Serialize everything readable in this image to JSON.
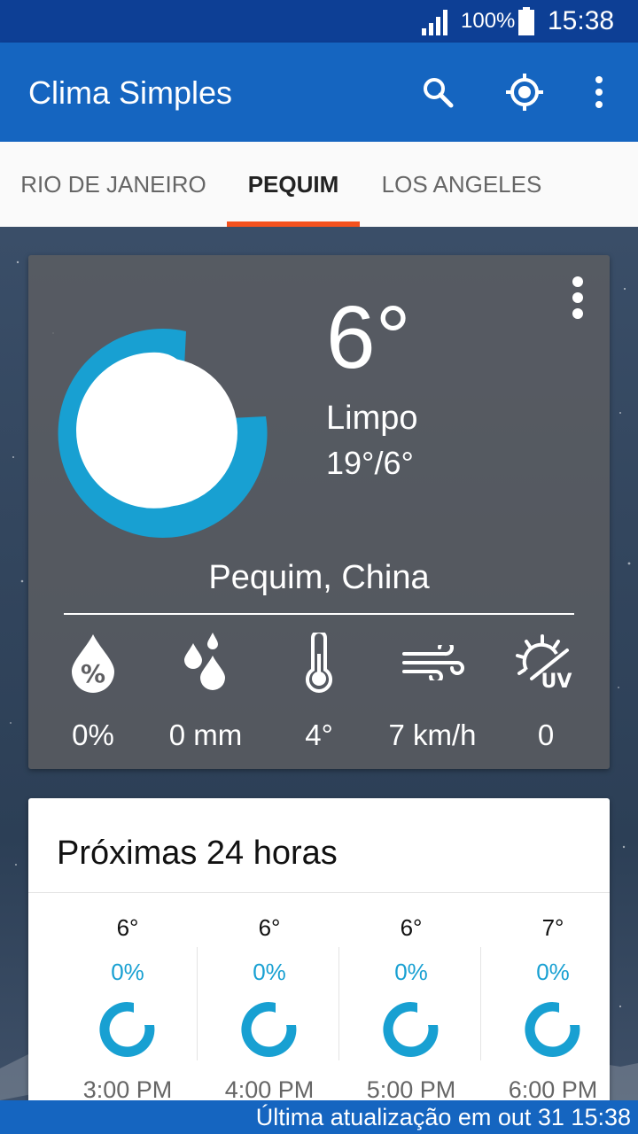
{
  "status_bar": {
    "battery_percent": "100%",
    "time": "15:38",
    "icons": [
      "signal-icon",
      "battery-icon"
    ]
  },
  "app_bar": {
    "title": "Clima Simples",
    "actions": [
      "search-icon",
      "my-location-icon",
      "overflow-menu-icon"
    ]
  },
  "tabs": [
    {
      "label": "RIO DE JANEIRO",
      "selected": false
    },
    {
      "label": "PEQUIM",
      "selected": true
    },
    {
      "label": "LOS ANGELES",
      "selected": false
    }
  ],
  "colors": {
    "primary": "#1565c0",
    "status_bar": "#0d3f95",
    "accent": "#f4511e",
    "moon_ring": "#18a0d2"
  },
  "current": {
    "temperature": "6°",
    "condition": "Limpo",
    "range": "19°/6°",
    "location": "Pequim, China",
    "icon": "clear-night-moon-icon",
    "stats": [
      {
        "icon": "precipitation-probability-icon",
        "value": "0%"
      },
      {
        "icon": "precipitation-amount-icon",
        "value": "0 mm"
      },
      {
        "icon": "thermometer-icon",
        "value": "4°"
      },
      {
        "icon": "wind-icon",
        "value": "7 km/h"
      },
      {
        "icon": "uv-index-icon",
        "value": "0"
      }
    ]
  },
  "hourly": {
    "title": "Próximas 24 horas",
    "items": [
      {
        "temp": "6°",
        "prob": "0%",
        "time": "3:00 PM",
        "icon": "moon-icon"
      },
      {
        "temp": "6°",
        "prob": "0%",
        "time": "4:00 PM",
        "icon": "moon-icon"
      },
      {
        "temp": "6°",
        "prob": "0%",
        "time": "5:00 PM",
        "icon": "moon-icon"
      },
      {
        "temp": "7°",
        "prob": "0%",
        "time": "6:00 PM",
        "icon": "moon-icon"
      }
    ]
  },
  "footer": {
    "last_update": "Última atualização em out 31 15:38"
  }
}
